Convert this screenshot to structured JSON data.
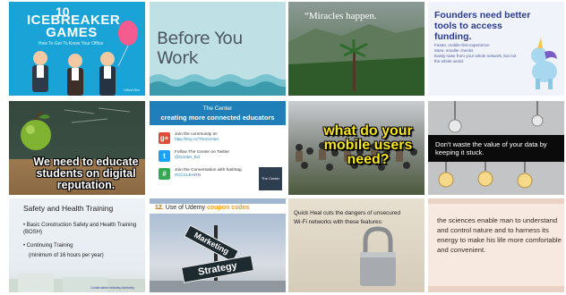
{
  "tiles": {
    "icebreaker": {
      "number": "10",
      "title": "ICEBREAKER GAMES",
      "subtitle": "How To Get To Know Your Office",
      "source": "OfficeVibe"
    },
    "before_you_work": {
      "text": "Before You Work"
    },
    "miracles": {
      "quote": "“Miracles happen."
    },
    "founders": {
      "title": "Founders need better tools to access funding.",
      "bullets": [
        "Faster, mobile-first experience",
        "More, smaller checks",
        "Easily raise from your whole network, but not",
        "the whole world."
      ]
    },
    "digital_reputation": {
      "caption": "We need to educate students on digital reputation."
    },
    "the_center": {
      "header_line1": "The Center",
      "header_line2": "creating more connected educators",
      "rows": [
        {
          "icon": "google-plus-icon",
          "text": "Join the community at:",
          "link": "http://tiny.cc/TheCenter",
          "color": "#dd4b39",
          "glyph": "g+"
        },
        {
          "icon": "twitter-icon",
          "text": "Follow The Center on Twitter",
          "link": "@Center_Ed",
          "color": "#1da1f2",
          "glyph": "t"
        },
        {
          "icon": "hashtag-icon",
          "text": "Join the Conversation with hashtag",
          "link": "#CCCLEARN",
          "color": "#35a852",
          "glyph": "#"
        }
      ],
      "badge": "The Center"
    },
    "mobile_users": {
      "question": "what do your mobile users need?"
    },
    "bulbs": {
      "text": "Don't waste the value of your data by keeping it stuck."
    },
    "construction": {
      "title": "Safety and     Health Training",
      "bullets": [
        "• Basic Construction Safety and Health Training (BOSH)",
        "• Continuing Training",
        "(minimum of 16 hours per year)"
      ],
      "footer": "Construction Industry Authority"
    },
    "strategy": {
      "heading_number": "12.",
      "heading_text": "Use of Udemy",
      "heading_keyword": "coupon codes",
      "sign1": "Marketing",
      "sign2": "Strategy"
    },
    "quick_heal": {
      "text": "Quick Heal cuts the dangers of unsecured Wi-Fi networks with these features:"
    },
    "sciences": {
      "text": "the sciences enable man to understand  and control nature and to harness its energy to make his life more comfortable and convenient."
    }
  }
}
